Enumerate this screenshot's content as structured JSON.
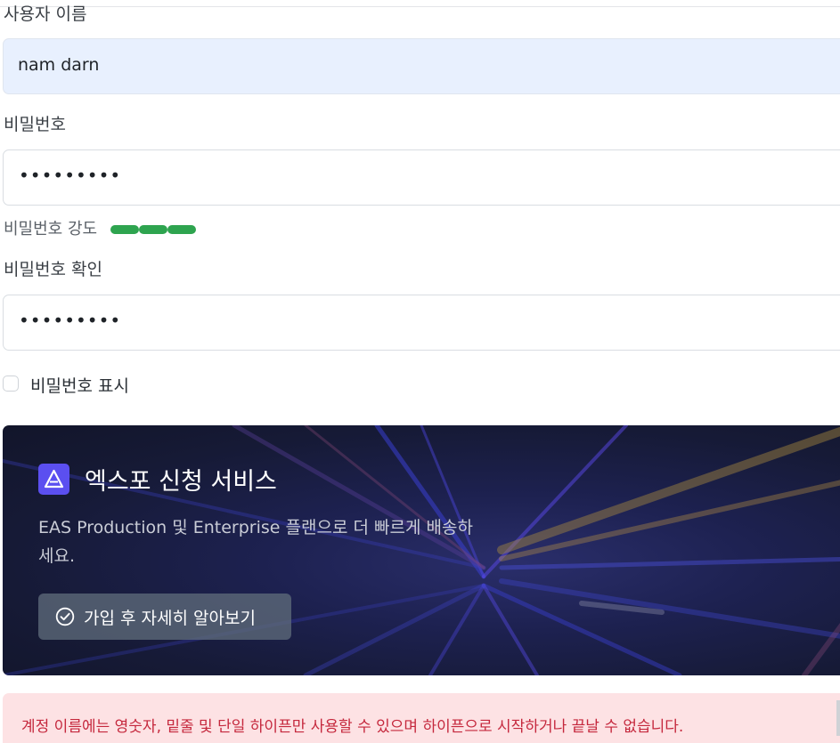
{
  "form": {
    "username_label": "사용자 이름",
    "username_value": "nam darn",
    "password_label": "비밀번호",
    "password_value": "•••••••••",
    "strength_label": "비밀번호 강도",
    "strength_segments_filled": 3,
    "strength_segments_total": 3,
    "strength_color": "#2ea44f",
    "confirm_label": "비밀번호 확인",
    "confirm_value": "•••••••••",
    "show_password_label": "비밀번호 표시",
    "show_password_checked": false
  },
  "promo": {
    "title": "엑스포 신청 서비스",
    "description": "EAS Production 및 Enterprise 플랜으로 더 빠르게 배송하세요.",
    "button_label": "가입 후 자세히 알아보기",
    "logo_icon": "expo-triangle-icon",
    "button_icon": "check-circle-icon",
    "accent_color": "#5b4ff0"
  },
  "error": {
    "message": "계정 이름에는 영숫자, 밑줄 및 단일 하이픈만 사용할 수 있으며 하이픈으로 시작하거나 끝날 수 없습니다.",
    "color": "#c5283d"
  }
}
